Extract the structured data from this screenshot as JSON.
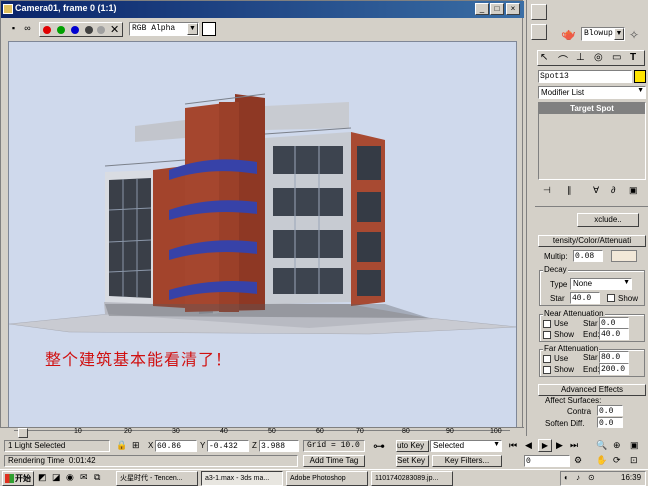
{
  "render_window": {
    "title": "Camera01, frame 0 (1:1)",
    "channel_select": "RGB Alpha",
    "caption": "整个建筑基本能看清了！"
  },
  "command_panel": {
    "category_dropdown": "Blowup",
    "object_name": "Spot13",
    "modifier_list": "Modifier List",
    "stack_item": "Target Spot",
    "exclude_button": "xclude..",
    "rollout_intensity": "tensity/Color/Attenuati",
    "multiplier_label": "Multip:",
    "multiplier_value": "0.08",
    "decay_label": "Decay",
    "decay_type_label": "Type",
    "decay_type_value": "None",
    "decay_start_label": "Star",
    "decay_start_value": "40.0",
    "decay_show_label": "Show",
    "near_atten_label": "Near Attenuation",
    "near_use": "Use",
    "near_show": "Show",
    "near_start_label": "Star",
    "near_start_value": "0.0",
    "near_end_label": "End:",
    "near_end_value": "40.0",
    "far_atten_label": "Far Attenuation",
    "far_use": "Use",
    "far_show": "Show",
    "far_start_label": "Star",
    "far_start_value": "80.0",
    "far_end_label": "End:",
    "far_end_value": "200.0",
    "rollout_advanced": "Advanced Effects",
    "affect_surfaces": "Affect Surfaces:",
    "contrast_label": "Contra",
    "contrast_value": "0.0",
    "soften_label": "Soften Diff.",
    "soften_value": "0.0"
  },
  "timeline": {
    "ticks": [
      "10",
      "20",
      "30",
      "40",
      "50",
      "60",
      "70",
      "80",
      "90",
      "100"
    ]
  },
  "status_bar": {
    "selection_info": "1 Light Selected",
    "x_label": "X",
    "x_value": "60.86",
    "y_label": "Y",
    "y_value": "-0.432",
    "z_label": "Z",
    "z_value": "3.988",
    "grid": "Grid = 10.0",
    "auto_key": "uto Key",
    "selected_dropdown": "Selected",
    "prompt": "Rendering Time  0:01:42",
    "add_time_tag": "Add Time Tag",
    "set_key": "Set Key",
    "key_filters": "Key Filters...",
    "frame_field": "0"
  },
  "taskbar": {
    "start": "开始",
    "tasks": [
      "火星时代 - Tencen...",
      "a3-1.max - 3ds ma...",
      "Adobe Photoshop",
      "1101740283089.jp..."
    ],
    "clock": "16:39"
  },
  "colors": {
    "title_bar": "#0a246a",
    "viewport_bg": "#cfd9ec",
    "caption": "#d01010",
    "brick": "#a3442c",
    "balcony_blue": "#3742a8"
  }
}
